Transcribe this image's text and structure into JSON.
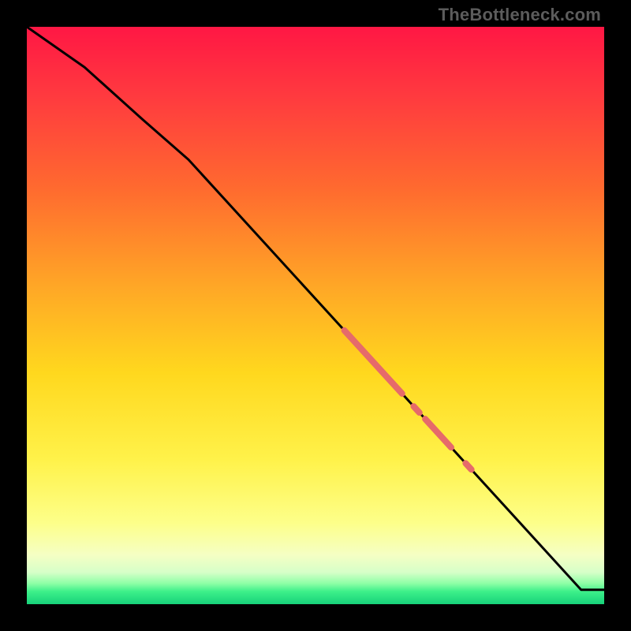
{
  "watermark": "TheBottleneck.com",
  "colors": {
    "background": "#000000",
    "curve": "#000000",
    "marker": "#e66a6a"
  },
  "gradient_stops": [
    {
      "offset": 0.0,
      "color": "#ff1744"
    },
    {
      "offset": 0.12,
      "color": "#ff3a3f"
    },
    {
      "offset": 0.28,
      "color": "#ff6a2f"
    },
    {
      "offset": 0.45,
      "color": "#ffa726"
    },
    {
      "offset": 0.6,
      "color": "#ffd81e"
    },
    {
      "offset": 0.75,
      "color": "#fff24a"
    },
    {
      "offset": 0.86,
      "color": "#fdff8a"
    },
    {
      "offset": 0.915,
      "color": "#f5ffc4"
    },
    {
      "offset": 0.945,
      "color": "#d6ffc8"
    },
    {
      "offset": 0.964,
      "color": "#8effa6"
    },
    {
      "offset": 0.978,
      "color": "#3df08a"
    },
    {
      "offset": 1.0,
      "color": "#17d27a"
    }
  ],
  "chart_data": {
    "type": "line",
    "title": "",
    "xlabel": "",
    "ylabel": "",
    "xlim": [
      0,
      100
    ],
    "ylim": [
      0,
      100
    ],
    "series": [
      {
        "name": "curve",
        "x": [
          0,
          10,
          20,
          28,
          96,
          100
        ],
        "y": [
          100,
          93,
          84,
          77,
          2.5,
          2.5
        ]
      }
    ],
    "markers": [
      {
        "name": "band-1",
        "x_start": 55.0,
        "x_end": 65.0,
        "thickness": 8
      },
      {
        "name": "dot-1",
        "x_start": 67.0,
        "x_end": 68.0,
        "thickness": 8
      },
      {
        "name": "band-2",
        "x_start": 69.0,
        "x_end": 73.5,
        "thickness": 8
      },
      {
        "name": "dot-2",
        "x_start": 76.0,
        "x_end": 77.0,
        "thickness": 8
      }
    ]
  }
}
